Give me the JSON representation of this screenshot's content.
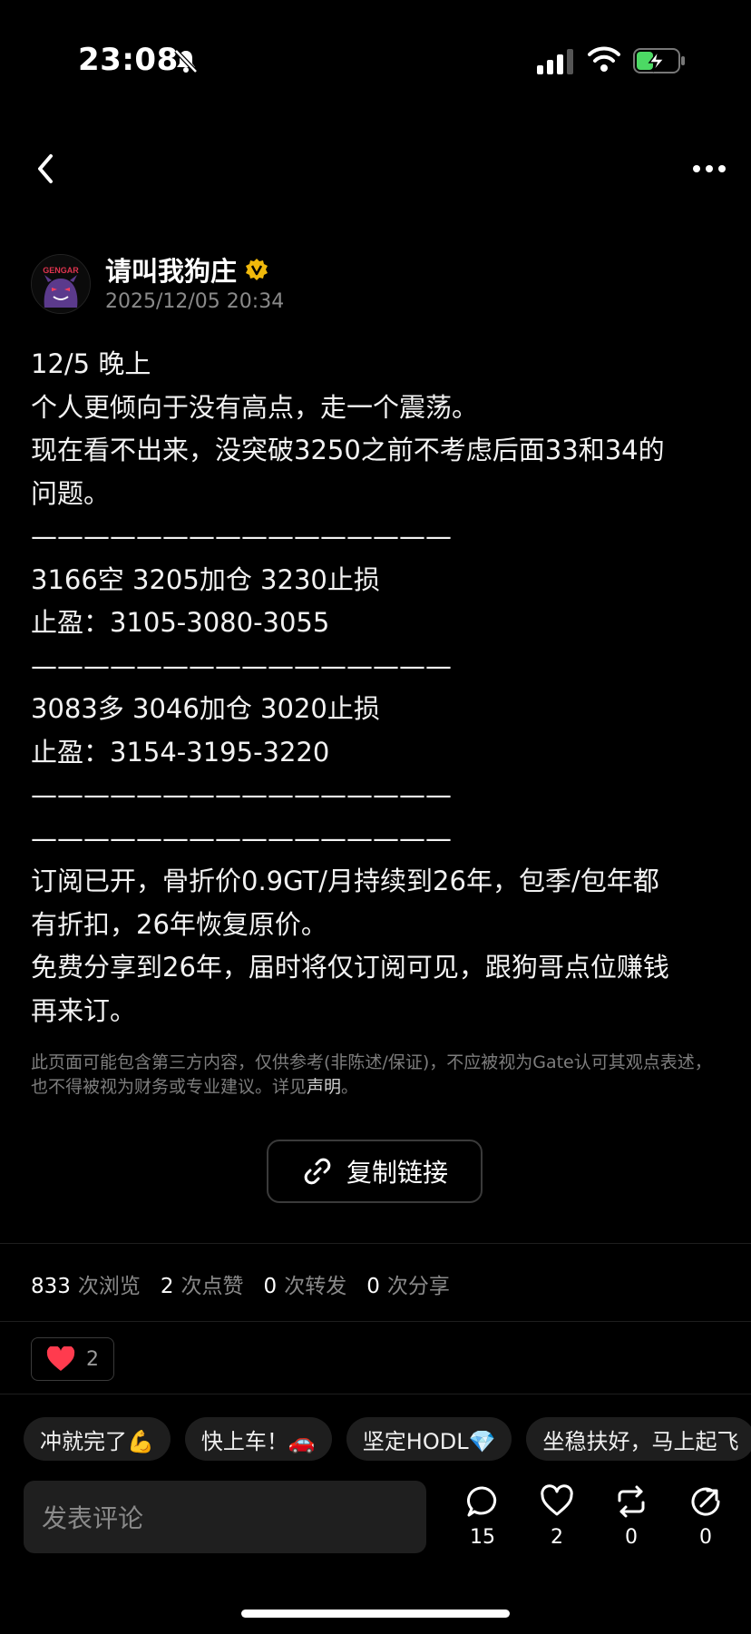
{
  "status_bar": {
    "time": "23:08"
  },
  "author": {
    "name": "请叫我狗庄",
    "date": "2025/12/05 20:34",
    "avatar_text": "GENGAR"
  },
  "post_lines": [
    "12/5  晚上",
    "个人更倾向于没有高点，走一个震荡。",
    "现在看不出来，没突破3250之前不考虑后面33和34的",
    "问题。",
    " ————————————————",
    "3166空 3205加仓 3230止损",
    "止盈：3105-3080-3055",
    "————————————————",
    "3083多 3046加仓  3020止损",
    "止盈：3154-3195-3220",
    "————————————————",
    "————————————————",
    " 订阅已开，骨折价0.9GT/月持续到26年，包季/包年都",
    "有折扣，26年恢复原价。",
    "免费分享到26年，届时将仅订阅可见，跟狗哥点位赚钱",
    "再来订。"
  ],
  "disclaimer": {
    "text": "此页面可能包含第三方内容，仅供参考(非陈述/保证)，不应被视为Gate认可其观点表述，也不得被视为财务或专业建议。详见",
    "link": "声明",
    "end": "。"
  },
  "copy_link_label": "复制链接",
  "stats": {
    "views": "833",
    "views_label": "次浏览",
    "likes": "2",
    "likes_label": "次点赞",
    "reposts": "0",
    "reposts_label": "次转发",
    "shares": "0",
    "shares_label": "次分享"
  },
  "reaction": {
    "icon": "heart-icon",
    "count": "2"
  },
  "quick_replies": [
    "冲就完了💪",
    "快上车！🚗",
    "坚定HODL💎",
    "坐稳扶好，马上起飞"
  ],
  "comment_placeholder": "发表评论",
  "actions": {
    "comments": "15",
    "likes": "2",
    "reposts": "0",
    "shares": "0"
  },
  "colors": {
    "background": "#000000",
    "verified": "#f0b90b",
    "heart": "#ff3b4e",
    "battery": "#4cd964"
  }
}
